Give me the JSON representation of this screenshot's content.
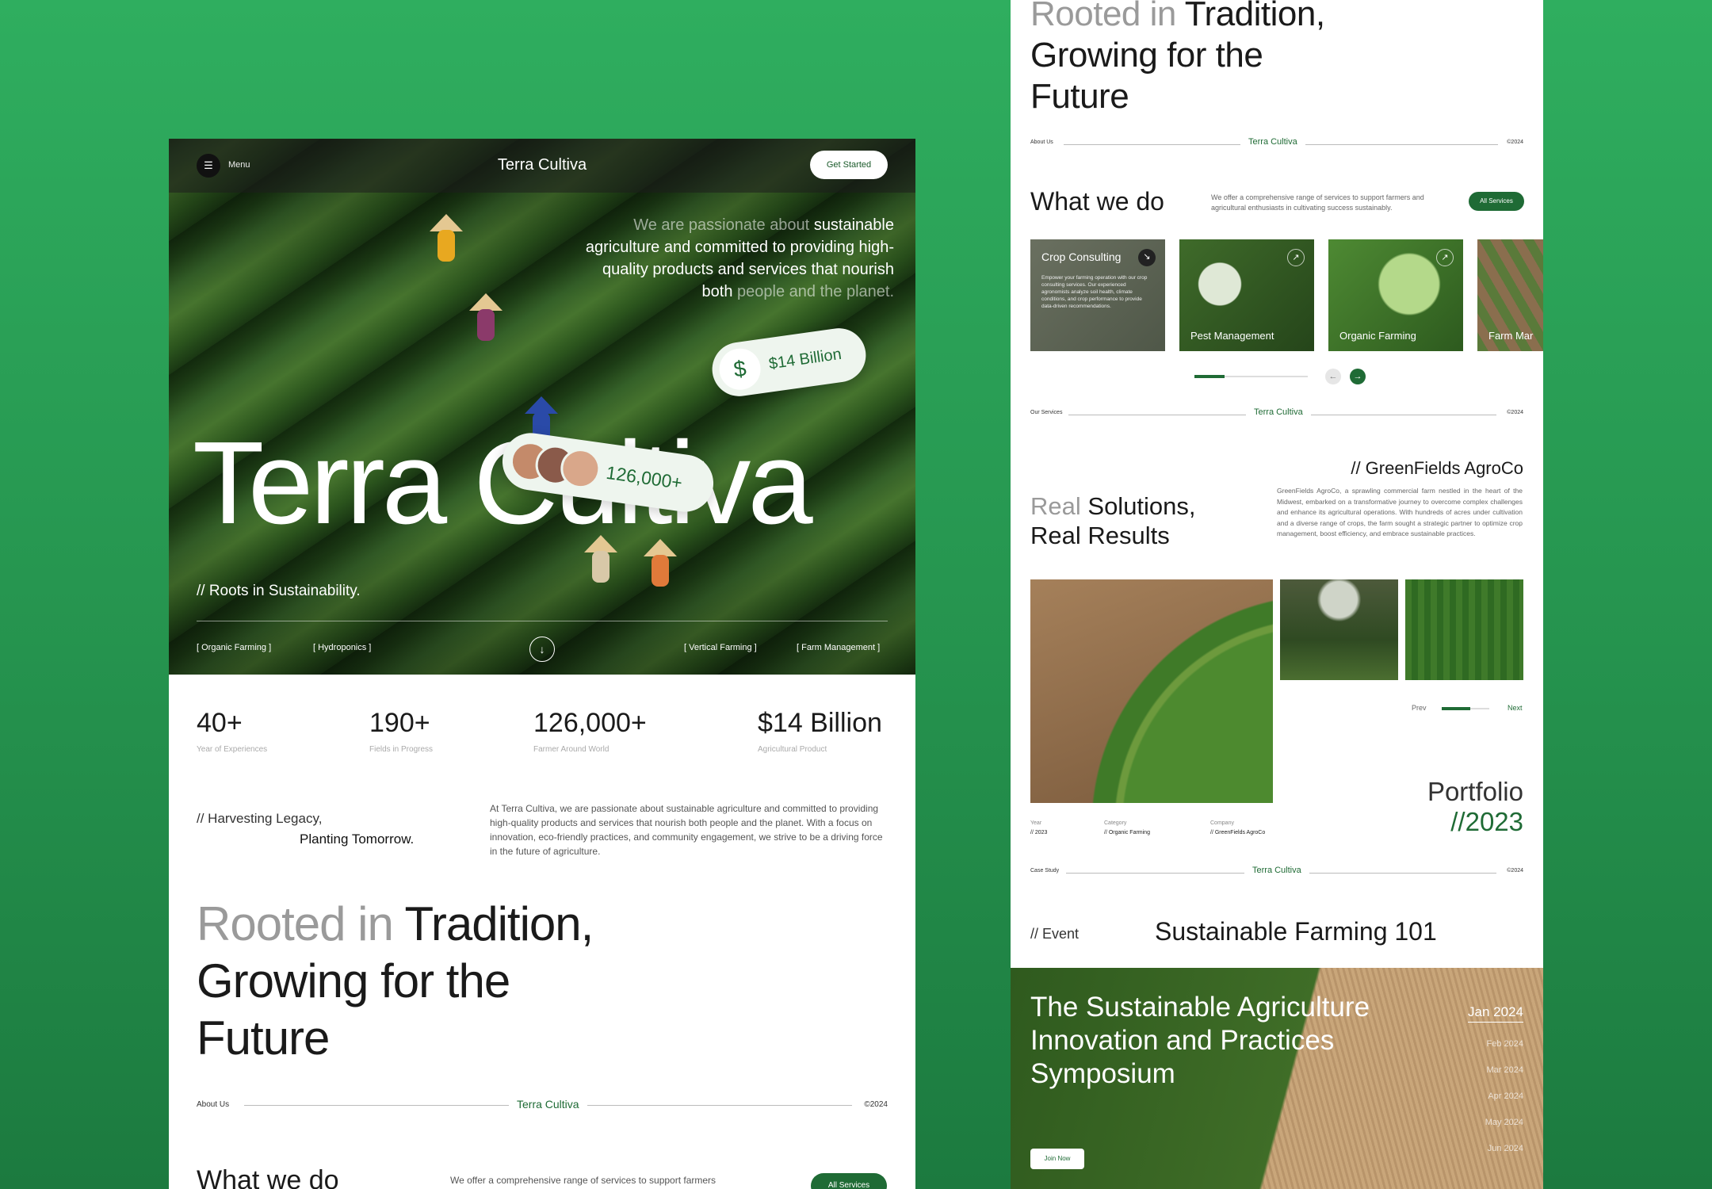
{
  "left": {
    "nav": {
      "menu_icon": "☰",
      "menu_label": "Menu",
      "brand": "Terra Cultiva",
      "cta": "Get Started"
    },
    "hero": {
      "tagline_muted": "We are passionate about",
      "tagline_main": "sustainable agriculture and committed to providing high-quality products and services that nourish both",
      "tagline_end": "people and the planet.",
      "title": "Terra Cultiva",
      "pill_money_icon": "$",
      "pill_money": "$14 Billion",
      "pill_users": "126,000+",
      "roots": "// Roots in Sustainability.",
      "tags": [
        "[ Organic Farming ]",
        "[ Hydroponics ]",
        "[ Vertical Farming ]",
        "[ Farm Management ]"
      ],
      "scroll_icon": "↓"
    },
    "stats": [
      {
        "value": "40+",
        "label": "Year of Experiences"
      },
      {
        "value": "190+",
        "label": "Fields in Progress"
      },
      {
        "value": "126,000+",
        "label": "Farmer Around World"
      },
      {
        "value": "$14 Billion",
        "label": "Agricultural Product"
      }
    ],
    "harvest": {
      "line1": "// Harvesting Legacy,",
      "line2": "Planting Tomorrow."
    },
    "about_text": "At Terra Cultiva, we are passionate about sustainable agriculture and committed to providing high-quality products and services that nourish both people and the planet. With a focus on innovation, eco-friendly practices, and community engagement, we strive to be a driving force in the future of agriculture.",
    "rooted": {
      "muted": "Rooted in",
      "l1": "Tradition,",
      "l2": "Growing for the",
      "l3": "Future"
    },
    "about_divider": {
      "left": "About Us",
      "mid": "Terra Cultiva",
      "right": "©2024"
    },
    "wwd": {
      "title": "What we do",
      "desc": "We offer a comprehensive range of services to support farmers",
      "button": "All Services"
    }
  },
  "right": {
    "rooted": {
      "muted": "Rooted in",
      "l1": "Tradition,",
      "l2": "Growing for the",
      "l3": "Future"
    },
    "about_divider": {
      "left": "About Us",
      "mid": "Terra Cultiva",
      "right": "©2024"
    },
    "wwd": {
      "title": "What we do",
      "desc": "We offer a comprehensive range of services to support farmers and agricultural enthusiasts in cultivating success sustainably.",
      "button": "All Services"
    },
    "cards": [
      {
        "title": "Crop Consulting",
        "desc": "Empower your farming operation with our crop consulting services. Our experienced agronomists analyze soil health, climate conditions, and crop performance to provide data-driven recommendations.",
        "icon": "↘"
      },
      {
        "title": "Pest Management",
        "icon": "↗"
      },
      {
        "title": "Organic Farming",
        "icon": "↗"
      },
      {
        "title": "Farm Mar",
        "icon": "↗"
      }
    ],
    "slider": {
      "prev_icon": "←",
      "next_icon": "→"
    },
    "services_divider": {
      "left": "Our Services",
      "mid": "Terra Cultiva",
      "right": "©2024"
    },
    "case": {
      "client": "// GreenFields AgroCo",
      "title_muted": "Real",
      "title_l1": "Solutions,",
      "title_l2": "Real Results",
      "desc": "GreenFields AgroCo, a sprawling commercial farm nestled in the heart of the Midwest, embarked on a transformative journey to overcome complex challenges and enhance its agricultural operations. With hundreds of acres under cultivation and a diverse range of crops, the farm sought a strategic partner to optimize crop management, boost efficiency, and embrace sustainable practices.",
      "prev": "Prev",
      "next": "Next",
      "portfolio": "Portfolio",
      "portfolio_year": "//2023",
      "meta": [
        {
          "label": "Year",
          "value": "// 2023"
        },
        {
          "label": "Category",
          "value": "// Organic Farming"
        },
        {
          "label": "Company",
          "value": "// GreenFields AgroCo"
        }
      ]
    },
    "case_divider": {
      "left": "Case Study",
      "mid": "Terra Cultiva",
      "right": "©2024"
    },
    "event": {
      "label": "// Event",
      "title": "Sustainable Farming 101",
      "headline": [
        "The Sustainable Agriculture",
        "Innovation and Practices",
        "Symposium"
      ],
      "dates": [
        "Jan 2024",
        "Feb 2024",
        "Mar 2024",
        "Apr 2024",
        "May 2024",
        "Jun 2024"
      ],
      "join": "Join Now"
    }
  }
}
